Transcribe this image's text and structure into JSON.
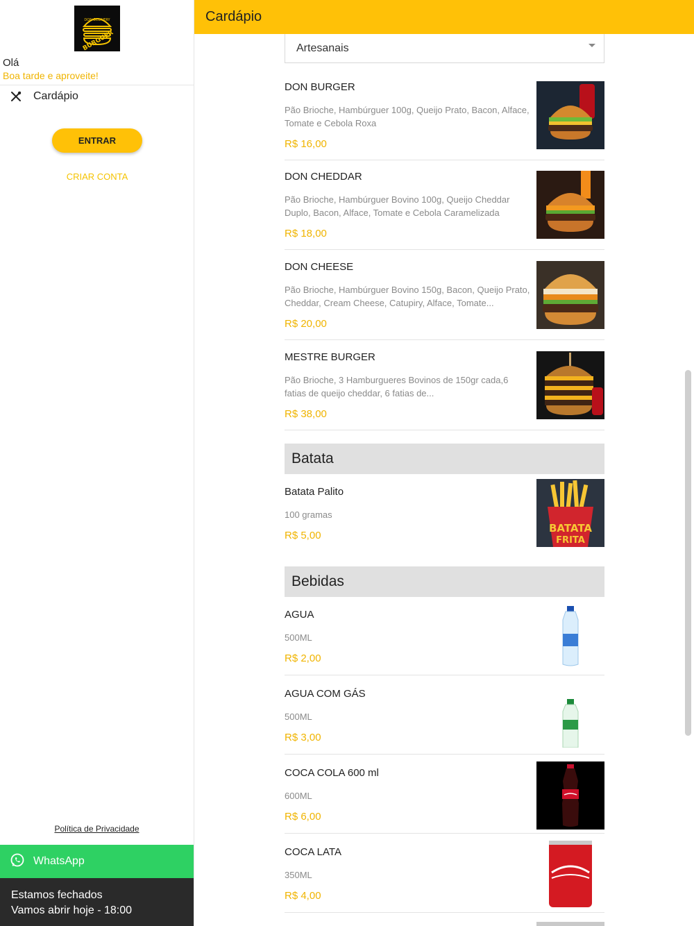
{
  "header": {
    "title": "Cardápio"
  },
  "sidebar": {
    "logo_text_top": "DON DELIVERY",
    "logo_text_main": "BURGUER",
    "greeting": "Olá",
    "greeting_sub": "Boa tarde e aproveite!",
    "menu_label": "Cardápio",
    "enter_label": "ENTRAR",
    "create_label": "CRIAR CONTA",
    "privacy_label": "Política de Privacidade",
    "whatsapp_label": "WhatsApp",
    "status_line1": "Estamos fechados",
    "status_line2": "Vamos abrir hoje - 18:00"
  },
  "category_select": {
    "value": "Artesanais"
  },
  "artesanais": [
    {
      "name": "DON BURGER",
      "desc": "Pão Brioche, Hambúrguer 100g, Queijo Prato, Bacon, Alface, Tomate e Cebola Roxa",
      "price": "R$ 16,00"
    },
    {
      "name": "DON CHEDDAR",
      "desc": "Pão Brioche, Hambúrguer Bovino 100g, Queijo Cheddar Duplo, Bacon, Alface, Tomate e Cebola Caramelizada",
      "price": "R$ 18,00"
    },
    {
      "name": "DON CHEESE",
      "desc": "Pão Brioche, Hambúrguer Bovino 150g, Bacon, Queijo Prato, Cheddar, Cream Cheese, Catupiry, Alface, Tomate...",
      "price": "R$ 20,00"
    },
    {
      "name": "MESTRE BURGER",
      "desc": "Pão Brioche, 3 Hamburgueres Bovinos de 150gr cada,6 fatias de queijo cheddar, 6 fatias de...",
      "price": "R$ 38,00"
    }
  ],
  "sections": {
    "batata": "Batata",
    "bebidas": "Bebidas"
  },
  "batata": [
    {
      "name": "Batata Palito",
      "desc": "100 gramas",
      "price": "R$ 5,00",
      "img_text1": "BATATA",
      "img_text2": "FRITA"
    }
  ],
  "bebidas": [
    {
      "name": "AGUA",
      "desc": "500ML",
      "price": "R$ 2,00"
    },
    {
      "name": "AGUA COM GÁS",
      "desc": "500ML",
      "price": "R$ 3,00"
    },
    {
      "name": "COCA COLA 600 ml",
      "desc": "600ML",
      "price": "R$ 6,00"
    },
    {
      "name": "COCA LATA",
      "desc": "350ML",
      "price": "R$ 4,00"
    }
  ],
  "colors": {
    "accent": "#ffc107",
    "price": "#f0b400",
    "whatsapp": "#2ed163",
    "status_bg": "#2a2a2a"
  }
}
